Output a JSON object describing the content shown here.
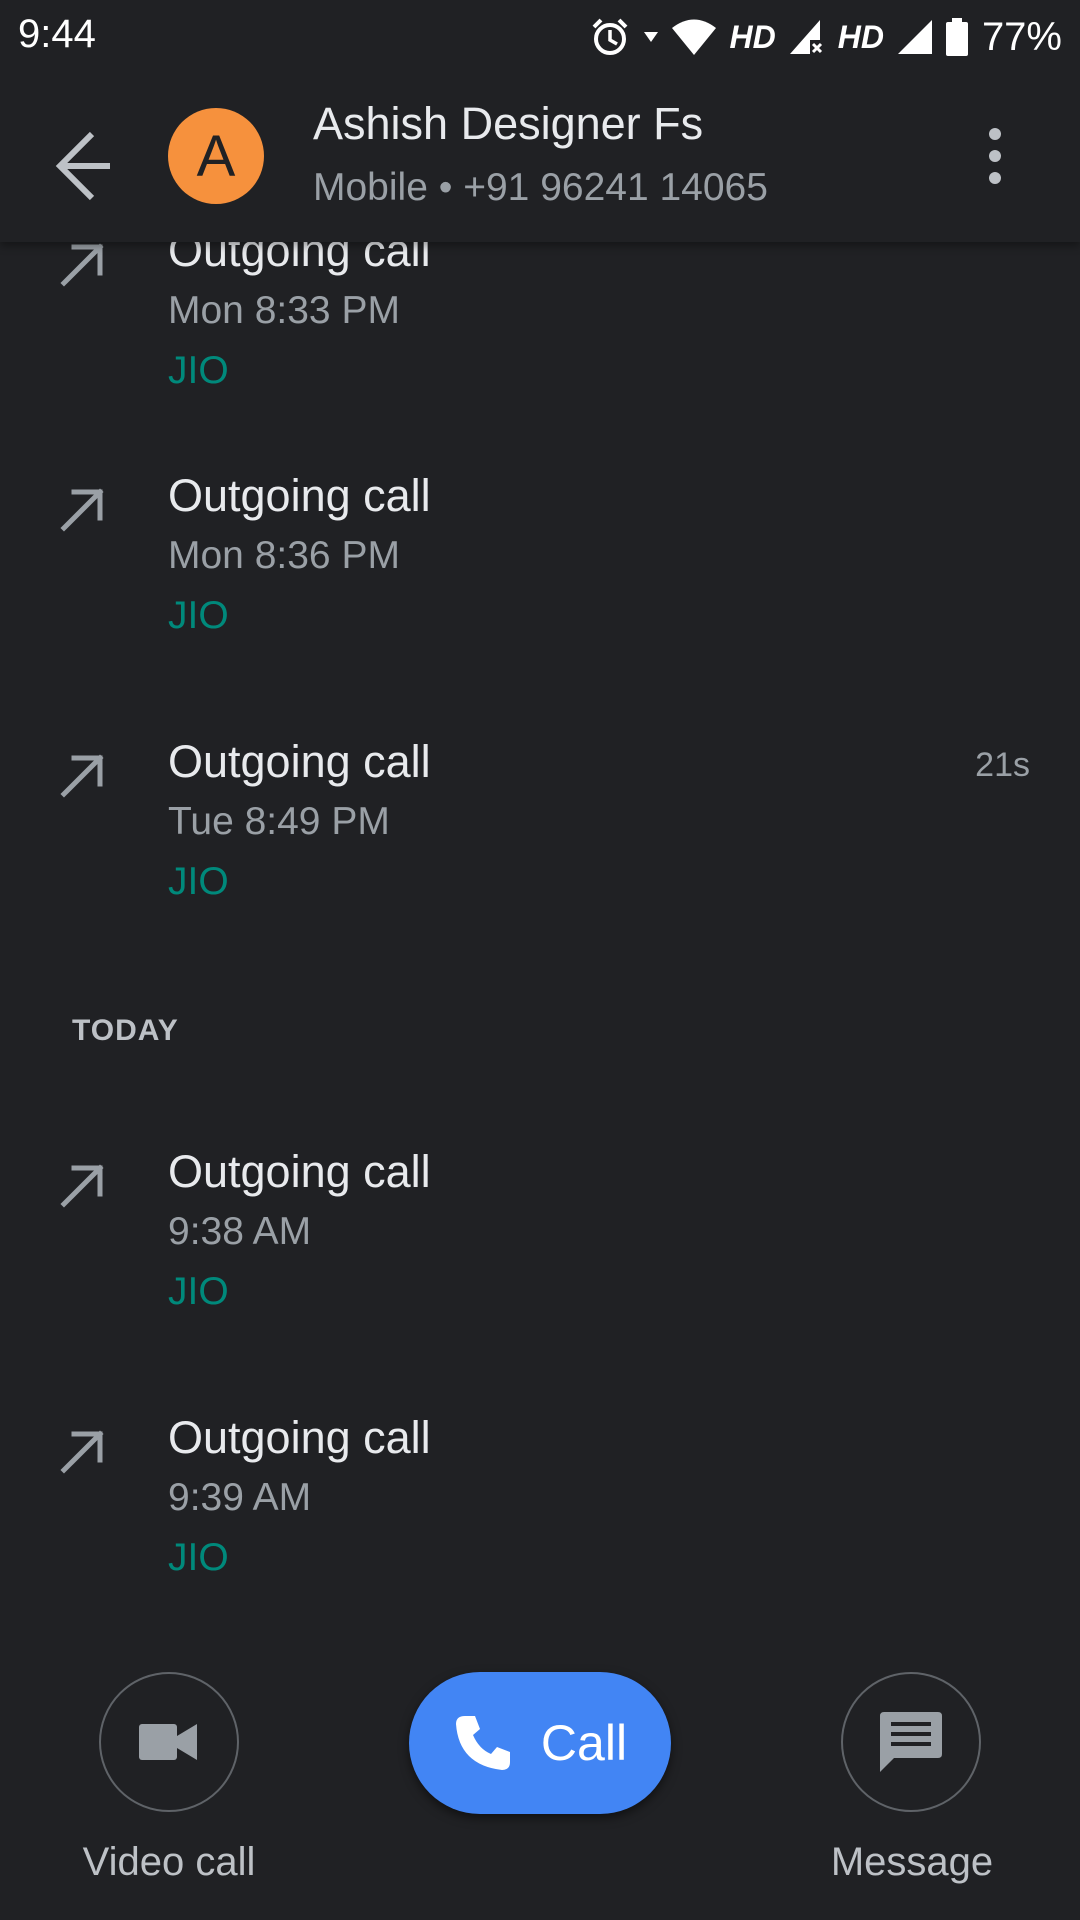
{
  "status_bar": {
    "time": "9:44",
    "hd1": "HD",
    "hd2": "HD",
    "battery": "77%"
  },
  "header": {
    "contact_initial": "A",
    "contact_name": "Ashish Designer Fs",
    "contact_number": "Mobile • +91 96241 14065"
  },
  "calls": [
    {
      "type": "Outgoing call",
      "time": "Mon 8:33 PM",
      "carrier": "JIO",
      "duration": ""
    },
    {
      "type": "Outgoing call",
      "time": "Mon 8:36 PM",
      "carrier": "JIO",
      "duration": ""
    },
    {
      "type": "Outgoing call",
      "time": "Tue 8:49 PM",
      "carrier": "JIO",
      "duration": "21s"
    },
    {
      "type": "Outgoing call",
      "time": "9:38 AM",
      "carrier": "JIO",
      "duration": ""
    },
    {
      "type": "Outgoing call",
      "time": "9:39 AM",
      "carrier": "JIO",
      "duration": ""
    }
  ],
  "section_today": "TODAY",
  "actions": {
    "video_call": "Video call",
    "call": "Call",
    "message": "Message"
  },
  "colors": {
    "background": "#202124",
    "avatar": "#f6913d",
    "carrier": "#00897b",
    "call_button": "#4285f4"
  },
  "icons": {
    "call_arrow": "outgoing-call-arrow-icon",
    "back": "arrow-left-icon",
    "more": "more-vert-icon",
    "video": "videocam-icon",
    "phone": "phone-icon",
    "message": "message-icon"
  }
}
